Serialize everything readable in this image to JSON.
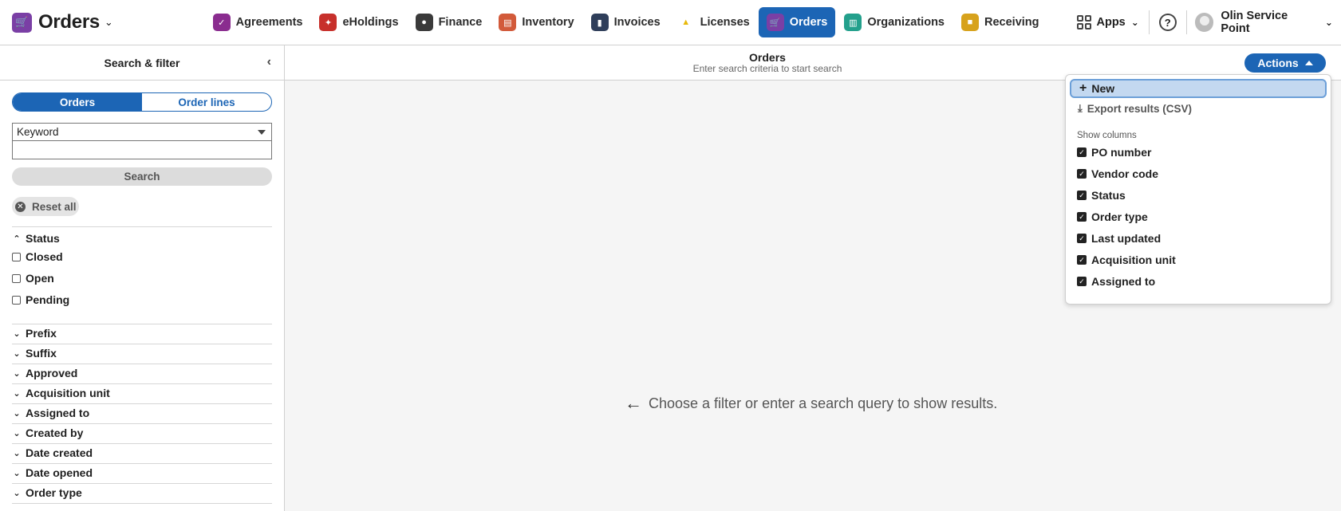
{
  "app": {
    "name": "Orders",
    "icon": "cart-icon"
  },
  "nav": {
    "items": [
      {
        "label": "Agreements",
        "icon": "agreements-icon",
        "color": "#8a2c8f"
      },
      {
        "label": "eHoldings",
        "icon": "eholdings-icon",
        "color": "#c7302b"
      },
      {
        "label": "Finance",
        "icon": "finance-icon",
        "color": "#3a3a3a"
      },
      {
        "label": "Inventory",
        "icon": "inventory-icon",
        "color": "#d25a3a"
      },
      {
        "label": "Invoices",
        "icon": "invoices-icon",
        "color": "#2f3e5a"
      },
      {
        "label": "Licenses",
        "icon": "licenses-icon",
        "color": "#e8b90a"
      },
      {
        "label": "Orders",
        "icon": "cart-icon",
        "color": "#7a3fa5"
      },
      {
        "label": "Organizations",
        "icon": "organizations-icon",
        "color": "#23a08c"
      },
      {
        "label": "Receiving",
        "icon": "receiving-icon",
        "color": "#d7a21c"
      }
    ],
    "apps_label": "Apps",
    "help_label": "?",
    "user_label": "Olin Service Point"
  },
  "filter_pane": {
    "title": "Search & filter",
    "segments": [
      "Orders",
      "Order lines"
    ],
    "keyword_option": "Keyword",
    "search_value": "",
    "search_label": "Search",
    "reset_label": "Reset all",
    "status": {
      "label": "Status",
      "options": [
        "Closed",
        "Open",
        "Pending"
      ]
    },
    "accordions": [
      "Prefix",
      "Suffix",
      "Approved",
      "Acquisition unit",
      "Assigned to",
      "Created by",
      "Date created",
      "Date opened",
      "Order type"
    ]
  },
  "main": {
    "title": "Orders",
    "subtitle": "Enter search criteria to start search",
    "actions_label": "Actions",
    "empty_message": "Choose a filter or enter a search query to show results."
  },
  "actions_menu": {
    "new_label": "New",
    "export_label": "Export results (CSV)",
    "section_label": "Show columns",
    "columns": [
      "PO number",
      "Vendor code",
      "Status",
      "Order type",
      "Last updated",
      "Acquisition unit",
      "Assigned to"
    ]
  },
  "colors": {
    "accent": "#1c65b5",
    "highlight": "#c3d8f0"
  }
}
